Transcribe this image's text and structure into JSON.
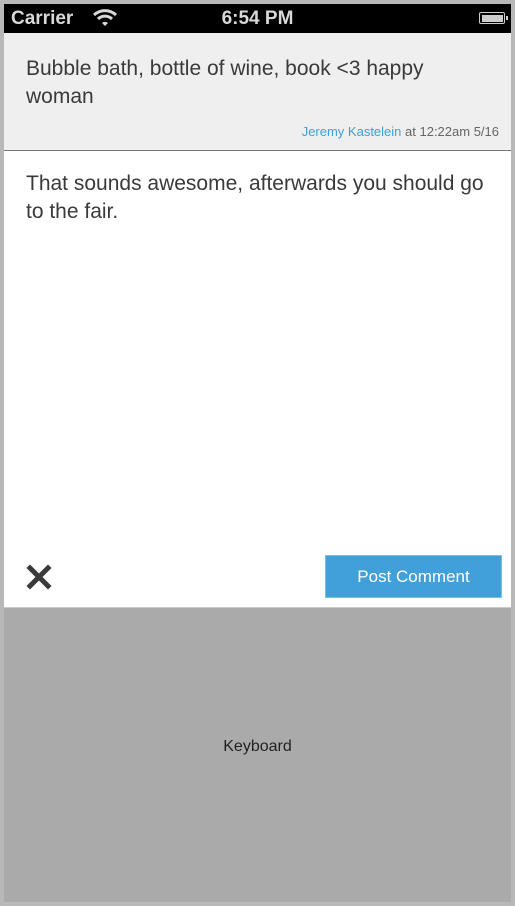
{
  "status_bar": {
    "carrier": "Carrier",
    "time": "6:54 PM"
  },
  "post": {
    "text": "Bubble bath, bottle of wine, book <3 happy woman",
    "author": "Jeremy Kastelein",
    "timestamp": "at 12:22am 5/16"
  },
  "comment": {
    "value": "That sounds awesome, afterwards you should go to the fair."
  },
  "actions": {
    "post_label": "Post Comment"
  },
  "keyboard": {
    "label": "Keyboard"
  },
  "colors": {
    "accent": "#419fd9",
    "header_bg": "#efefef",
    "keyboard_bg": "#aaaaaa"
  }
}
